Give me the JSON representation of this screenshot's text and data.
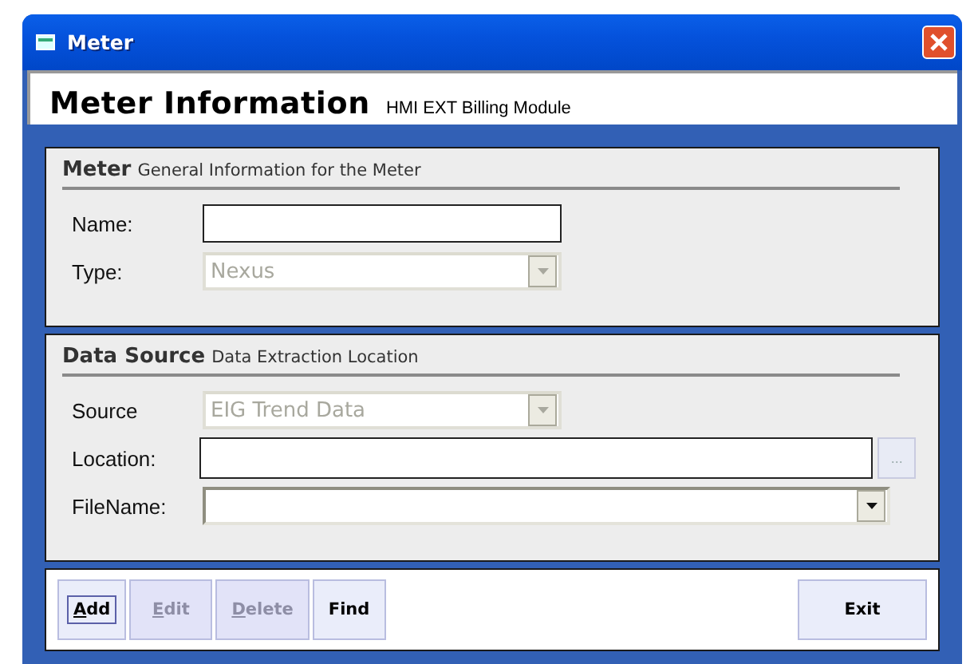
{
  "window": {
    "title": "Meter"
  },
  "header": {
    "title": "Meter Information",
    "subtitle": "HMI EXT Billing Module"
  },
  "sections": [
    {
      "title": "Meter",
      "subtitle": "General Information for the Meter",
      "fields": [
        {
          "label": "Name:",
          "kind": "text",
          "disabled": false
        },
        {
          "label": "Type:",
          "kind": "combo",
          "value": "Nexus",
          "disabled": true
        }
      ]
    },
    {
      "title": "Data Source",
      "subtitle": "Data Extraction Location",
      "fields": [
        {
          "label": "Source",
          "kind": "combo",
          "value": "EIG Trend Data",
          "disabled": true
        },
        {
          "label": "Location:",
          "kind": "browse",
          "disabled": false,
          "browse_label": "...",
          "browse_disabled": true
        },
        {
          "label": "FileName:",
          "kind": "wide-combo",
          "disabled": false
        }
      ]
    }
  ],
  "buttons": [
    {
      "label": "Add",
      "disabled": false,
      "focused": true,
      "mnemonic": true
    },
    {
      "label": "Edit",
      "disabled": true,
      "focused": false,
      "mnemonic": true
    },
    {
      "label": "Delete",
      "disabled": true,
      "focused": false,
      "mnemonic": true
    },
    {
      "label": "Find",
      "disabled": false,
      "focused": false,
      "mnemonic": false
    },
    {
      "label": "Exit",
      "disabled": false,
      "focused": false,
      "mnemonic": false
    }
  ]
}
